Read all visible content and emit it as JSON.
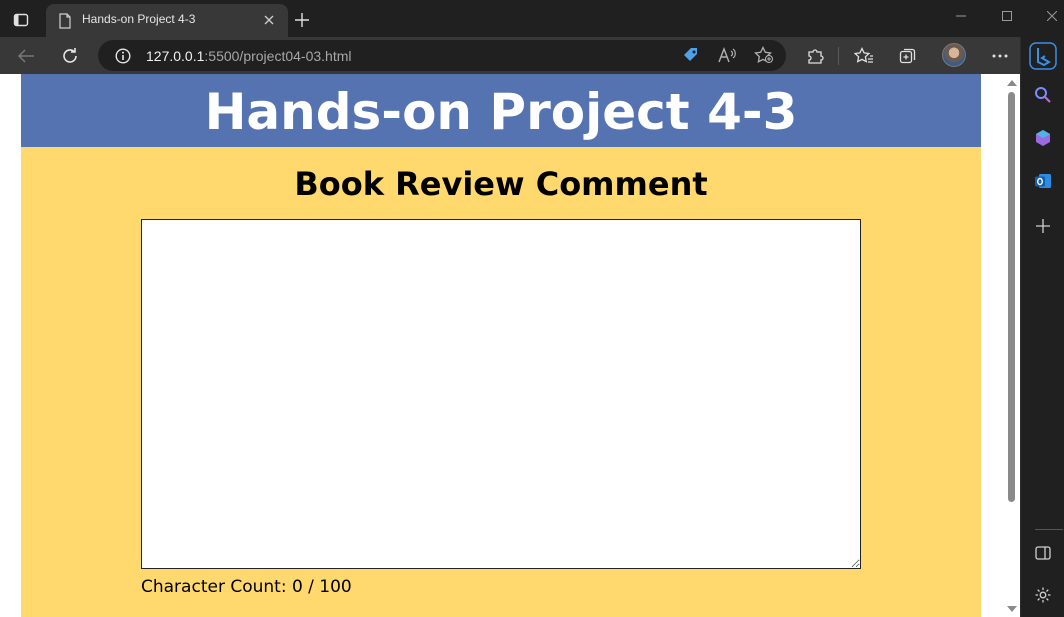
{
  "browser": {
    "tab": {
      "title": "Hands-on Project 4-3"
    },
    "address": {
      "host": "127.0.0.1",
      "rest": ":5500/project04-03.html"
    }
  },
  "page": {
    "banner_title": "Hands-on Project 4-3",
    "heading": "Book Review Comment",
    "comment": {
      "value": ""
    },
    "character_count": "Character Count: 0 / 100"
  },
  "colors": {
    "banner": "#5572b1",
    "content_background": "#ffd96e",
    "chrome_dark": "#202020",
    "chrome_toolbar": "#383838"
  }
}
